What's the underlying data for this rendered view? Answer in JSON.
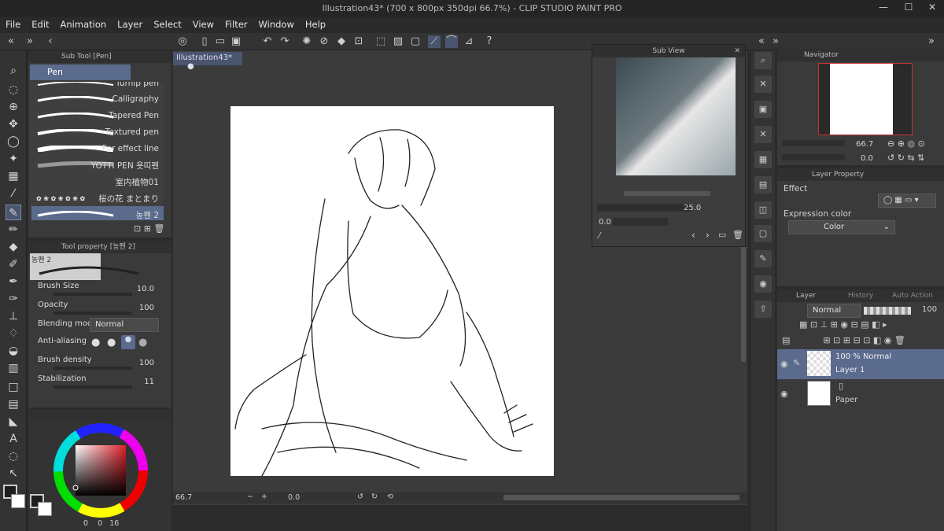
{
  "window": {
    "title": "Illustration43* (700 x 800px 350dpi 66.7%) - CLIP STUDIO PAINT PRO",
    "minimize": "—",
    "maximize": "☐",
    "close": "✕"
  },
  "menu": [
    "File",
    "Edit",
    "Animation",
    "Layer",
    "Select",
    "View",
    "Filter",
    "Window",
    "Help"
  ],
  "subtool": {
    "header": "Sub Tool [Pen]",
    "active_group": "Pen",
    "brushes": [
      {
        "label": "Turnip pen"
      },
      {
        "label": "Calligraphy"
      },
      {
        "label": "Tapered Pen"
      },
      {
        "label": "Textured pen"
      },
      {
        "label": "For effect line"
      },
      {
        "label": "YOTTI PEN 욧띠펜"
      },
      {
        "label": "室内植物01"
      },
      {
        "label": "桜の花 まとまり"
      },
      {
        "label": "농펜 2"
      }
    ]
  },
  "toolprop": {
    "header": "Tool property [농펜 2]",
    "preset": "농펜 2",
    "rows": [
      {
        "label": "Brush Size",
        "value": "10.0"
      },
      {
        "label": "Opacity",
        "value": "100"
      },
      {
        "label": "Blending mode",
        "value": "Normal"
      },
      {
        "label": "Anti-aliasing",
        "value": ""
      },
      {
        "label": "Brush density",
        "value": "100"
      },
      {
        "label": "Stabilization",
        "value": "11"
      }
    ]
  },
  "color": {
    "main": "#1e1e1e",
    "sub": "#ffffff",
    "status": [
      "0",
      "0",
      "16"
    ]
  },
  "canvas": {
    "doc_tab": "Illustration43*",
    "zoom": "66.7",
    "rotation": "0.0"
  },
  "subview": {
    "header": "Sub View",
    "zoom": "25.0",
    "rotation": "0.0"
  },
  "navigator": {
    "header": "Navigator",
    "zoom": "66.7",
    "rotation": "0.0"
  },
  "layer_property": {
    "header": "Layer Property",
    "effect_label": "Effect",
    "expression_color_label": "Expression color",
    "expression_color_value": "Color"
  },
  "layer_panel": {
    "tabs": [
      "Layer",
      "History",
      "Auto Action"
    ],
    "blend_mode": "Normal",
    "opacity": "100",
    "layers": [
      {
        "opacity_mode": "100 % Normal",
        "name": "Layer 1"
      },
      {
        "opacity_mode": "",
        "name": "Paper"
      }
    ]
  },
  "accent": "#5b6b8e"
}
